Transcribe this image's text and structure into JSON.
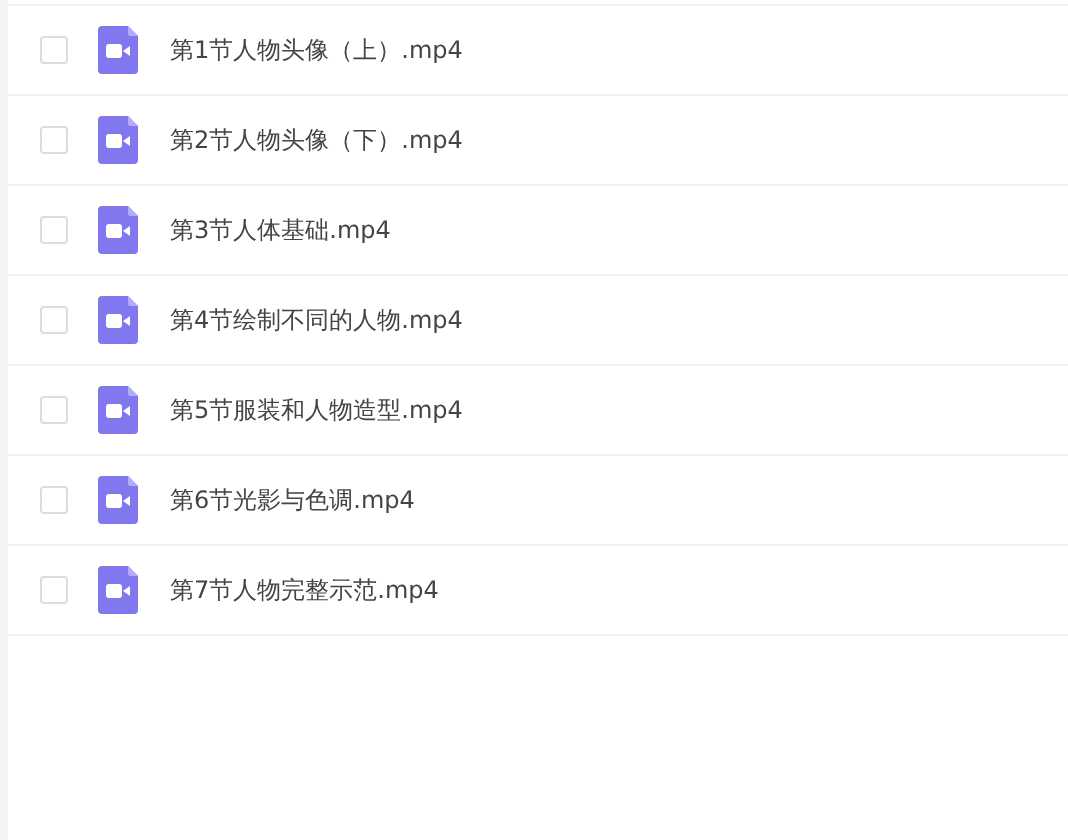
{
  "files": [
    {
      "name": "第1节人物头像（上）.mp4",
      "checked": false
    },
    {
      "name": "第2节人物头像（下）.mp4",
      "checked": false
    },
    {
      "name": "第3节人体基础.mp4",
      "checked": false
    },
    {
      "name": "第4节绘制不同的人物.mp4",
      "checked": false
    },
    {
      "name": "第5节服装和人物造型.mp4",
      "checked": false
    },
    {
      "name": "第6节光影与色调.mp4",
      "checked": false
    },
    {
      "name": "第7节人物完整示范.mp4",
      "checked": false
    }
  ]
}
